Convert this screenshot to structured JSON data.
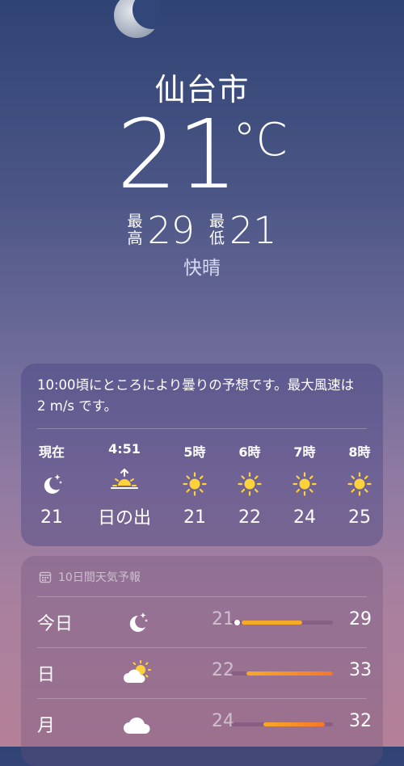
{
  "location": {
    "city": "仙台市"
  },
  "current": {
    "temp": "21",
    "unit": "°C",
    "high_label": [
      "最",
      "高"
    ],
    "high": "29",
    "low_label": [
      "最",
      "低"
    ],
    "low": "21",
    "condition": "快晴"
  },
  "hourly": {
    "summary": "10:00頃にところにより曇りの予想です。最大風速は2 m/s です。",
    "items": [
      {
        "time": "現在",
        "icon": "moon-stars-icon",
        "value": "21"
      },
      {
        "time": "4:51",
        "icon": "sunrise-icon",
        "value": "日の出"
      },
      {
        "time": "5時",
        "icon": "sun-icon",
        "value": "21"
      },
      {
        "time": "6時",
        "icon": "sun-icon",
        "value": "22"
      },
      {
        "time": "7時",
        "icon": "sun-icon",
        "value": "24"
      },
      {
        "time": "8時",
        "icon": "sun-icon",
        "value": "25"
      }
    ]
  },
  "forecast": {
    "header": "10日間天気予報",
    "days": [
      {
        "day": "今日",
        "icon": "moon-stars-icon",
        "low": "21",
        "high": "29",
        "range_start": 0.1,
        "range_end": 0.7,
        "current_marker": true
      },
      {
        "day": "日",
        "icon": "sun-cloud-icon",
        "low": "22",
        "high": "33",
        "range_start": 0.15,
        "range_end": 1.0,
        "current_marker": false
      },
      {
        "day": "月",
        "icon": "cloud-icon",
        "low": "24",
        "high": "32",
        "range_start": 0.32,
        "range_end": 0.92,
        "current_marker": false
      }
    ]
  },
  "colors": {
    "sun": "#ffd23a",
    "bar_warm": "#f7a928",
    "bar_hot": "#f6762c"
  }
}
